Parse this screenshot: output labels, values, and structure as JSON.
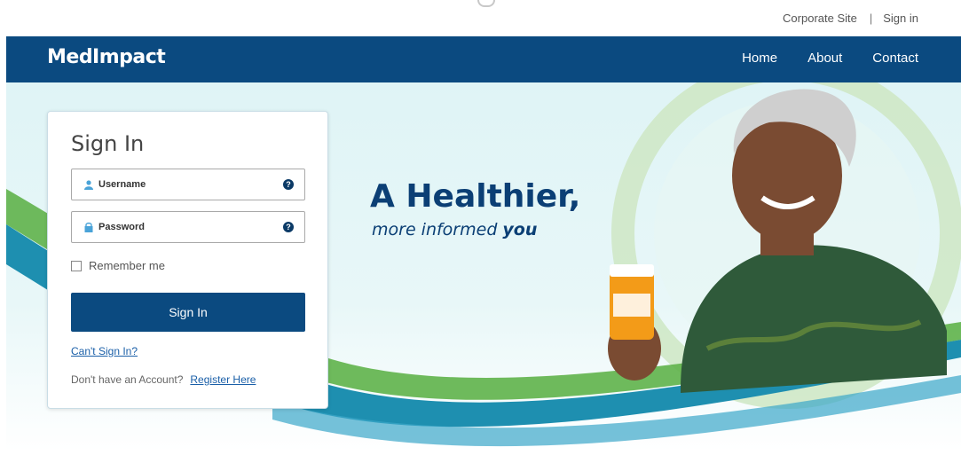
{
  "top_bar": {
    "corporate_site": "Corporate Site",
    "separator": "|",
    "sign_in": "Sign in"
  },
  "nav": {
    "logo": "MedImpact",
    "links": [
      "Home",
      "About",
      "Contact"
    ]
  },
  "signin_card": {
    "title": "Sign In",
    "username_placeholder": "Username",
    "password_placeholder": "Password",
    "help_glyph": "?",
    "remember_label": "Remember me",
    "submit_label": "Sign In",
    "cant_sign_in": "Can't Sign In?",
    "no_account_text": "Don't have an Account?",
    "register_link": "Register Here"
  },
  "hero": {
    "headline": "A Healthier,",
    "subline_prefix": "more informed ",
    "subline_emphasis": "you"
  },
  "colors": {
    "brand_navy": "#0b4a80",
    "headline_blue": "#0b3f75",
    "swoosh_green": "#5fb34a",
    "swoosh_teal": "#1e8fb0",
    "link_blue": "#1a5fa8"
  },
  "icons": {
    "username": "user-icon",
    "password": "lock-icon",
    "help": "help-icon"
  }
}
